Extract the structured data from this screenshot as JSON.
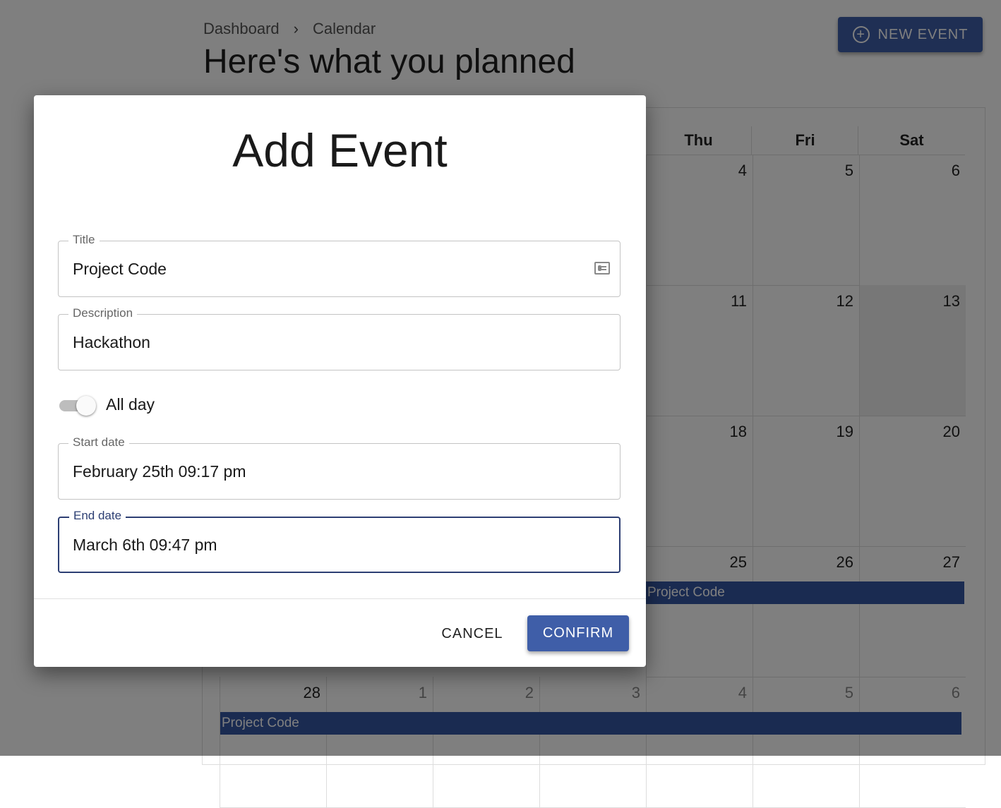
{
  "breadcrumb": {
    "items": [
      "Dashboard",
      "Calendar"
    ],
    "separator": "›"
  },
  "page_title": "Here's what you planned",
  "new_event_button": {
    "label": "NEW EVENT",
    "icon": "add-circle-icon"
  },
  "calendar": {
    "weekday_headers": [
      "Thu",
      "Fri",
      "Sat"
    ],
    "weeks": [
      [
        "",
        "",
        "",
        "",
        "4",
        "5",
        "6"
      ],
      [
        "",
        "",
        "",
        "",
        "11",
        "12",
        "13"
      ],
      [
        "",
        "",
        "",
        "",
        "18",
        "19",
        "20"
      ],
      [
        "",
        "",
        "",
        "",
        "25",
        "26",
        "27"
      ],
      [
        "28",
        "1",
        "2",
        "3",
        "4",
        "5",
        "6"
      ]
    ],
    "events": [
      {
        "title": "Project Code"
      },
      {
        "title": "Project Code"
      }
    ]
  },
  "dialog": {
    "title": "Add Event",
    "fields": {
      "title": {
        "label": "Title",
        "value": "Project Code",
        "icon": "contact-card-icon"
      },
      "description": {
        "label": "Description",
        "value": "Hackathon"
      },
      "start_date": {
        "label": "Start date",
        "value": "February 25th 09:17 pm"
      },
      "end_date": {
        "label": "End date",
        "value": "March 6th 09:47 pm"
      }
    },
    "all_day": {
      "label": "All day",
      "checked": true
    },
    "cancel_label": "CANCEL",
    "confirm_label": "CONFIRM"
  },
  "colors": {
    "primary": "#3f5ea8",
    "event": "#3556a3",
    "focus": "#2d3f73"
  }
}
